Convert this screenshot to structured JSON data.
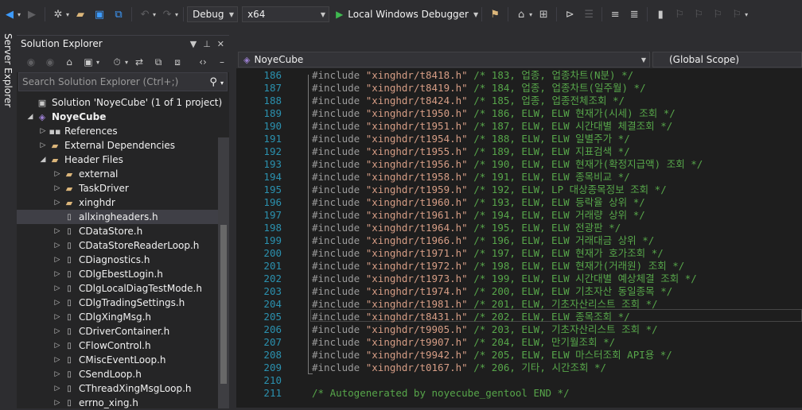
{
  "toolbar": {
    "config": "Debug",
    "platform": "x64",
    "debugger": "Local Windows Debugger"
  },
  "side_strip": {
    "tab": "Server Explorer"
  },
  "solution_explorer": {
    "title": "Solution Explorer",
    "search_placeholder": "Search Solution Explorer (Ctrl+;)",
    "tree": [
      {
        "label": "Solution 'NoyeCube' (1 of 1 project)",
        "depth": 0,
        "expander": "",
        "icon": "solution-icon",
        "glyph": "▣",
        "cls": "sol",
        "bold": false,
        "selected": false
      },
      {
        "label": "NoyeCube",
        "depth": 0,
        "expander": "◢",
        "icon": "project-icon",
        "glyph": "◈",
        "cls": "proj",
        "bold": true,
        "selected": false
      },
      {
        "label": "References",
        "depth": 1,
        "expander": "▷",
        "icon": "references-icon",
        "glyph": "▪▪",
        "cls": "ref",
        "bold": false,
        "selected": false
      },
      {
        "label": "External Dependencies",
        "depth": 1,
        "expander": "▷",
        "icon": "folder-icon",
        "glyph": "▰",
        "cls": "folder",
        "bold": false,
        "selected": false
      },
      {
        "label": "Header Files",
        "depth": 1,
        "expander": "◢",
        "icon": "folder-icon",
        "glyph": "▰",
        "cls": "folder",
        "bold": false,
        "selected": false
      },
      {
        "label": "external",
        "depth": 2,
        "expander": "▷",
        "icon": "folder-icon",
        "glyph": "▰",
        "cls": "folder",
        "bold": false,
        "selected": false
      },
      {
        "label": "TaskDriver",
        "depth": 2,
        "expander": "▷",
        "icon": "folder-icon",
        "glyph": "▰",
        "cls": "folder",
        "bold": false,
        "selected": false
      },
      {
        "label": "xinghdr",
        "depth": 2,
        "expander": "▷",
        "icon": "folder-icon",
        "glyph": "▰",
        "cls": "folder",
        "bold": false,
        "selected": false
      },
      {
        "label": "allxingheaders.h",
        "depth": 2,
        "expander": "",
        "icon": "header-file-icon",
        "glyph": "▯",
        "cls": "hfile",
        "bold": false,
        "selected": true
      },
      {
        "label": "CDataStore.h",
        "depth": 2,
        "expander": "▷",
        "icon": "header-file-icon",
        "glyph": "▯",
        "cls": "hfile",
        "bold": false,
        "selected": false
      },
      {
        "label": "CDataStoreReaderLoop.h",
        "depth": 2,
        "expander": "▷",
        "icon": "header-file-icon",
        "glyph": "▯",
        "cls": "hfile",
        "bold": false,
        "selected": false
      },
      {
        "label": "CDiagnostics.h",
        "depth": 2,
        "expander": "▷",
        "icon": "header-file-icon",
        "glyph": "▯",
        "cls": "hfile",
        "bold": false,
        "selected": false
      },
      {
        "label": "CDlgEbestLogin.h",
        "depth": 2,
        "expander": "▷",
        "icon": "header-file-icon",
        "glyph": "▯",
        "cls": "hfile",
        "bold": false,
        "selected": false
      },
      {
        "label": "CDlgLocalDiagTestMode.h",
        "depth": 2,
        "expander": "▷",
        "icon": "header-file-icon",
        "glyph": "▯",
        "cls": "hfile",
        "bold": false,
        "selected": false
      },
      {
        "label": "CDlgTradingSettings.h",
        "depth": 2,
        "expander": "▷",
        "icon": "header-file-icon",
        "glyph": "▯",
        "cls": "hfile",
        "bold": false,
        "selected": false
      },
      {
        "label": "CDlgXingMsg.h",
        "depth": 2,
        "expander": "▷",
        "icon": "header-file-icon",
        "glyph": "▯",
        "cls": "hfile",
        "bold": false,
        "selected": false
      },
      {
        "label": "CDriverContainer.h",
        "depth": 2,
        "expander": "▷",
        "icon": "header-file-icon",
        "glyph": "▯",
        "cls": "hfile",
        "bold": false,
        "selected": false
      },
      {
        "label": "CFlowControl.h",
        "depth": 2,
        "expander": "▷",
        "icon": "header-file-icon",
        "glyph": "▯",
        "cls": "hfile",
        "bold": false,
        "selected": false
      },
      {
        "label": "CMiscEventLoop.h",
        "depth": 2,
        "expander": "▷",
        "icon": "header-file-icon",
        "glyph": "▯",
        "cls": "hfile",
        "bold": false,
        "selected": false
      },
      {
        "label": "CSendLoop.h",
        "depth": 2,
        "expander": "▷",
        "icon": "header-file-icon",
        "glyph": "▯",
        "cls": "hfile",
        "bold": false,
        "selected": false
      },
      {
        "label": "CThreadXingMsgLoop.h",
        "depth": 2,
        "expander": "▷",
        "icon": "header-file-icon",
        "glyph": "▯",
        "cls": "hfile",
        "bold": false,
        "selected": false
      },
      {
        "label": "errno_xing.h",
        "depth": 2,
        "expander": "▷",
        "icon": "header-file-icon",
        "glyph": "▯",
        "cls": "hfile",
        "bold": false,
        "selected": false
      }
    ]
  },
  "editor": {
    "project_combo": "NoyeCube",
    "scope_combo": "(Global Scope)",
    "lines": [
      {
        "num": "186",
        "kw": "#include",
        "str": "\"xinghdr/t8418.h\"",
        "cm": "/* 183, 업종, 업종차트(N분) */"
      },
      {
        "num": "187",
        "kw": "#include",
        "str": "\"xinghdr/t8419.h\"",
        "cm": "/* 184, 업종, 업종차트(일주월) */"
      },
      {
        "num": "188",
        "kw": "#include",
        "str": "\"xinghdr/t8424.h\"",
        "cm": "/* 185, 업종, 업종전체조회 */"
      },
      {
        "num": "189",
        "kw": "#include",
        "str": "\"xinghdr/t1950.h\"",
        "cm": "/* 186, ELW, ELW 현재가(시세) 조회 */"
      },
      {
        "num": "190",
        "kw": "#include",
        "str": "\"xinghdr/t1951.h\"",
        "cm": "/* 187, ELW, ELW 시간대별 체결조회 */"
      },
      {
        "num": "191",
        "kw": "#include",
        "str": "\"xinghdr/t1954.h\"",
        "cm": "/* 188, ELW, ELW 일별주가 */"
      },
      {
        "num": "192",
        "kw": "#include",
        "str": "\"xinghdr/t1955.h\"",
        "cm": "/* 189, ELW, ELW 지표검색 */"
      },
      {
        "num": "193",
        "kw": "#include",
        "str": "\"xinghdr/t1956.h\"",
        "cm": "/* 190, ELW, ELW 현재가(확정지급액) 조회 */"
      },
      {
        "num": "194",
        "kw": "#include",
        "str": "\"xinghdr/t1958.h\"",
        "cm": "/* 191, ELW, ELW 종목비교 */"
      },
      {
        "num": "195",
        "kw": "#include",
        "str": "\"xinghdr/t1959.h\"",
        "cm": "/* 192, ELW, LP 대상종목정보 조회 */"
      },
      {
        "num": "196",
        "kw": "#include",
        "str": "\"xinghdr/t1960.h\"",
        "cm": "/* 193, ELW, ELW 등락율 상위 */"
      },
      {
        "num": "197",
        "kw": "#include",
        "str": "\"xinghdr/t1961.h\"",
        "cm": "/* 194, ELW, ELW 거래량 상위 */"
      },
      {
        "num": "198",
        "kw": "#include",
        "str": "\"xinghdr/t1964.h\"",
        "cm": "/* 195, ELW, ELW 전광판 */"
      },
      {
        "num": "199",
        "kw": "#include",
        "str": "\"xinghdr/t1966.h\"",
        "cm": "/* 196, ELW, ELW 거래대금 상위 */"
      },
      {
        "num": "200",
        "kw": "#include",
        "str": "\"xinghdr/t1971.h\"",
        "cm": "/* 197, ELW, ELW 현재가 호가조회 */"
      },
      {
        "num": "201",
        "kw": "#include",
        "str": "\"xinghdr/t1972.h\"",
        "cm": "/* 198, ELW, ELW 현재가(거래원) 조회 */"
      },
      {
        "num": "202",
        "kw": "#include",
        "str": "\"xinghdr/t1973.h\"",
        "cm": "/* 199, ELW, ELW 시간대별 예상체결 조회 */"
      },
      {
        "num": "203",
        "kw": "#include",
        "str": "\"xinghdr/t1974.h\"",
        "cm": "/* 200, ELW, ELW 기초자산 동일종목 */"
      },
      {
        "num": "204",
        "kw": "#include",
        "str": "\"xinghdr/t1981.h\"",
        "cm": "/* 201, ELW, 기초자산리스트 조회 */"
      },
      {
        "num": "205",
        "kw": "#include",
        "str": "\"xinghdr/t8431.h\"",
        "cm": "/* 202, ELW, ELW 종목조회 */"
      },
      {
        "num": "206",
        "kw": "#include",
        "str": "\"xinghdr/t9905.h\"",
        "cm": "/* 203, ELW, 기초자산리스트 조회 */"
      },
      {
        "num": "207",
        "kw": "#include",
        "str": "\"xinghdr/t9907.h\"",
        "cm": "/* 204, ELW, 만기월조회 */"
      },
      {
        "num": "208",
        "kw": "#include",
        "str": "\"xinghdr/t9942.h\"",
        "cm": "/* 205, ELW, ELW 마스터조회 API용 */"
      },
      {
        "num": "209",
        "kw": "#include",
        "str": "\"xinghdr/t0167.h\"",
        "cm": "/* 206, 기타, 시간조회 */"
      },
      {
        "num": "210",
        "kw": "",
        "str": "",
        "cm": ""
      },
      {
        "num": "211",
        "kw": "",
        "str": "",
        "cm": "/* Autogenerated by noyecube_gentool END */"
      }
    ]
  }
}
